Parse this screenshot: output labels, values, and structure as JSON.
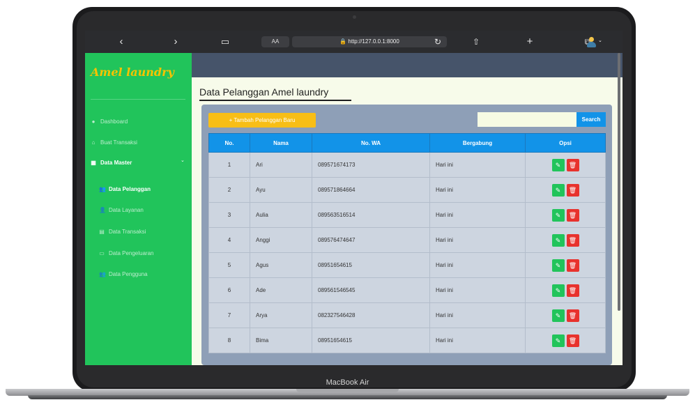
{
  "device": {
    "model": "MacBook Air"
  },
  "browser": {
    "back_icon": "chevron-left",
    "forward_icon": "chevron-right",
    "reader_icon": "book-icon",
    "text_size_label": "AA",
    "url": "http://127.0.0.1:8000",
    "reload_icon": "reload-icon",
    "share_icon": "share-icon",
    "new_tab_label": "+",
    "tabs_icon": "tabs-icon"
  },
  "sidebar": {
    "brand": "Amel laundry",
    "items": [
      {
        "label": "Dashboard",
        "icon": "gauge-icon"
      },
      {
        "label": "Buat Transaksi",
        "icon": "shop-icon"
      },
      {
        "label": "Data Master",
        "icon": "table-icon"
      }
    ],
    "sub_items": [
      {
        "label": "Data Pelanggan",
        "icon": "users-icon"
      },
      {
        "label": "Data Layanan",
        "icon": "user-tie-icon"
      },
      {
        "label": "Data Transaksi",
        "icon": "file-icon"
      },
      {
        "label": "Data Pengeluaran",
        "icon": "money-icon"
      },
      {
        "label": "Data Pengguna",
        "icon": "users-cog-icon"
      }
    ]
  },
  "main": {
    "title": "Data Pelanggan Amel laundry",
    "add_button": "+ Tambah Pelanggan Baru",
    "search_value": "",
    "search_button": "Search",
    "colors": {
      "sidebar": "#21c45b",
      "primary": "#1293e8",
      "warning": "#f8be16",
      "danger": "#e8322d"
    }
  },
  "table": {
    "headers": [
      "No.",
      "Nama",
      "No. WA",
      "Bergabung",
      "Opsi"
    ],
    "rows": [
      {
        "no": "1",
        "nama": "Ari",
        "wa": "089571674173",
        "bergabung": "Hari ini"
      },
      {
        "no": "2",
        "nama": "Ayu",
        "wa": "089571864664",
        "bergabung": "Hari ini"
      },
      {
        "no": "3",
        "nama": "Aulia",
        "wa": "089563516514",
        "bergabung": "Hari ini"
      },
      {
        "no": "4",
        "nama": "Anggi",
        "wa": "089576474647",
        "bergabung": "Hari ini"
      },
      {
        "no": "5",
        "nama": "Agus",
        "wa": "08951654615",
        "bergabung": "Hari ini"
      },
      {
        "no": "6",
        "nama": "Ade",
        "wa": "089561546545",
        "bergabung": "Hari ini"
      },
      {
        "no": "7",
        "nama": "Arya",
        "wa": "082327546428",
        "bergabung": "Hari ini"
      },
      {
        "no": "8",
        "nama": "Bima",
        "wa": "08951654615",
        "bergabung": "Hari ini"
      }
    ]
  }
}
